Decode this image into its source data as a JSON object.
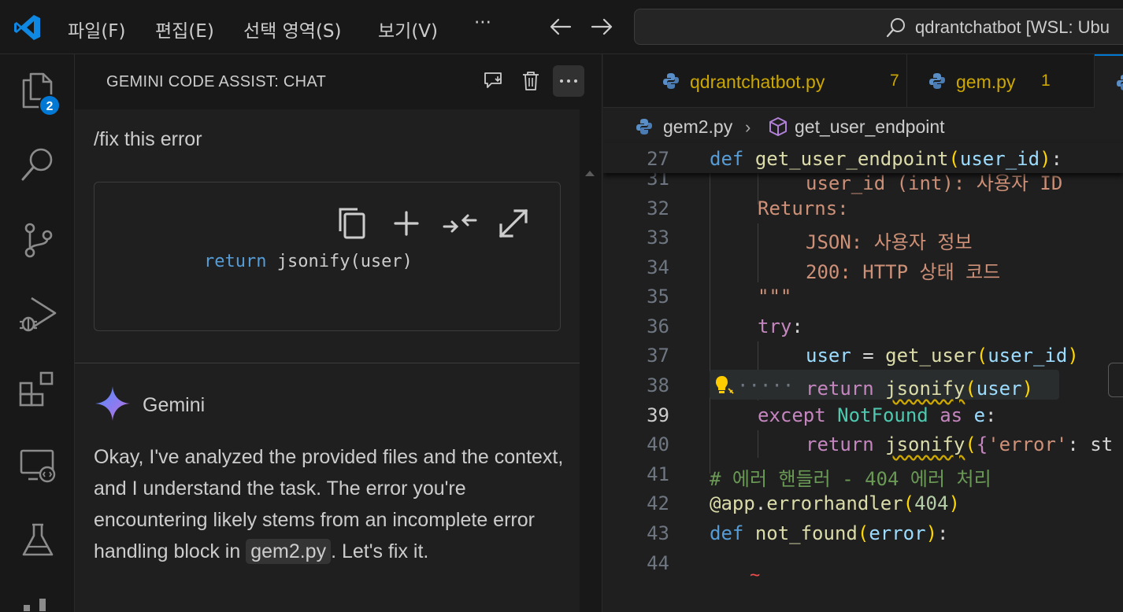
{
  "menu": {
    "file": "파일(F)",
    "edit": "편집(E)",
    "selection": "선택 영역(S)",
    "view": "보기(V)",
    "more": "···"
  },
  "search": {
    "text": "qdrantchatbot [WSL: Ubu"
  },
  "activity": {
    "explorer_badge": "2"
  },
  "sidebar": {
    "title": "GEMINI CODE ASSIST: CHAT",
    "user_message": "/fix this error",
    "code_snippet": {
      "keyword": "return",
      "rest": " jsonify(user)"
    },
    "assistant_name": "Gemini",
    "answer_before": "Okay, I've analyzed the provided files and the context, and I understand the task. The error you're encountering likely stems from an incomplete error handling block in ",
    "answer_code": "gem2.py",
    "answer_after": ". Let's fix it."
  },
  "tabs": [
    {
      "label": "qdrantchatbot.py",
      "count": "7"
    },
    {
      "label": "gem.py",
      "count": "1"
    }
  ],
  "breadcrumb": {
    "file": "gem2.py",
    "symbol": "get_user_endpoint"
  },
  "code": {
    "sticky": {
      "num": "27",
      "def": "def",
      "fn": "get_user_endpoint",
      "param": "user_id"
    },
    "l31": {
      "num": "31",
      "text": "user_id (int): 사용자 ID"
    },
    "l32": {
      "num": "32",
      "text": "Returns:"
    },
    "l33": {
      "num": "33",
      "text": "JSON: 사용자 정보"
    },
    "l34": {
      "num": "34",
      "text": "200: HTTP 상태 코드"
    },
    "l35": {
      "num": "35",
      "text": "\"\"\""
    },
    "l36": {
      "num": "36",
      "kw": "try",
      "colon": ":"
    },
    "l37": {
      "num": "37",
      "var": "user",
      "eq": " = ",
      "fn": "get_user",
      "arg": "user_id"
    },
    "l38": {
      "num": "38",
      "dots": "·····",
      "kw": "return",
      "fn": "jsonify",
      "arg": "user"
    },
    "l39": {
      "num": "39",
      "kw": "except",
      "cls": "NotFound",
      "as": "as",
      "var": "e",
      "colon": ":"
    },
    "l40": {
      "num": "40",
      "kw": "return",
      "fn": "jsonify",
      "str": "'error'",
      "rest": ": st"
    },
    "l41": {
      "num": "41",
      "text": "# 에러 핸들러 - 404 에러 처리"
    },
    "l42": {
      "num": "42",
      "deco": "@app",
      "dot": ".",
      "fn": "errorhandler",
      "arg": "404"
    },
    "l43": {
      "num": "43",
      "def": "def",
      "fn": "not_found",
      "arg": "error"
    },
    "l44": {
      "num": "44",
      "err": "~"
    }
  }
}
